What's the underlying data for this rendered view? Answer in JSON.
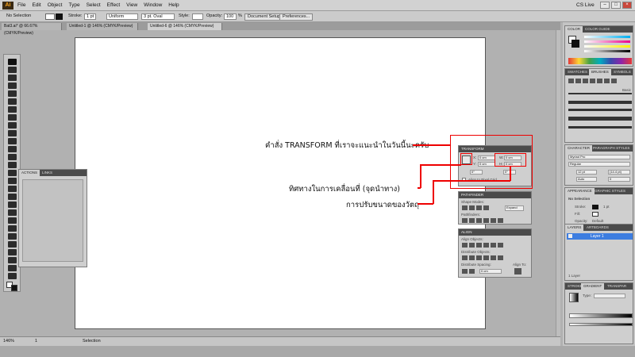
{
  "app": {
    "logo": "Ai",
    "menu": [
      "File",
      "Edit",
      "Object",
      "Type",
      "Select",
      "Effect",
      "View",
      "Window",
      "Help"
    ],
    "cs_live": "CS Live"
  },
  "window_controls": {
    "minimize": "–",
    "restore": "□",
    "close": "×"
  },
  "control_bar": {
    "selection": "No Selection",
    "stroke_label": "Stroke:",
    "stroke_value": "1 pt",
    "uniform": "Uniform",
    "brush": "3 pt. Oval",
    "style_label": "Style:",
    "opacity_label": "Opacity:",
    "opacity_value": "100",
    "opacity_unit": "%",
    "document_setup": "Document Setup",
    "preferences": "Preferences..."
  },
  "doc_tabs": [
    "Bat3.ai* @ 66.67% (CMYK/Preview)",
    "Untitled-1 @ 146% (CMYK/Preview)",
    "Untitled-6 @ 146% (CMYK/Preview)"
  ],
  "actions_panel": {
    "tab1": "ACTIONS",
    "tab2": "LINKS"
  },
  "transform_panel": {
    "title": "TRANSFORM",
    "x_label": "X:",
    "x_value": "0 cm",
    "y_label": "Y:",
    "y_value": "0 cm",
    "w_label": "W:",
    "w_value": "0 cm",
    "h_label": "H:",
    "h_value": "0 cm",
    "rotate_value": "0°",
    "shear_value": "0°",
    "align_grid": "Align to Pixel Grid"
  },
  "pathfinder_panel": {
    "title": "PATHFINDER",
    "shape_modes": "Shape Modes:",
    "expand": "Expand",
    "pathfinders": "Pathfinders:"
  },
  "align_panel": {
    "title": "ALIGN",
    "align_objects": "Align Objects:",
    "distribute_objects": "Distribute Objects:",
    "distribute_spacing": "Distribute Spacing:",
    "align_to": "Align To:",
    "spacing_value": "0 cm"
  },
  "annotations": {
    "transform_note": "คำสั่ง TRANSFORM ที่เราจะแนะนำในวันนี้นะครับ",
    "direction_note": "ทิศทางในการเคลื่อนที่ (จุดนำทาง)",
    "resize_note": "การปรับขนาดของวัตถุ"
  },
  "right_dock": {
    "color_tab": "COLOR",
    "color_guide_tab": "COLOR GUIDE",
    "swatches_tab": "SWATCHES",
    "brushes_tab": "BRUSHES",
    "symbols_tab": "SYMBOLS",
    "brush_basic": "Basic",
    "character_tab": "CHARACTER",
    "paragraph_tab": "PARAGRAPH STYLES",
    "font": "Myriad Pro",
    "font_style": "Regular",
    "font_size": "12 pt",
    "leading": "(14.4 pt)",
    "kerning": "Auto",
    "tracking": "0",
    "appearance_tab": "APPEARANCE",
    "graphic_styles_tab": "GRAPHIC STYLES",
    "no_selection": "No Selection",
    "stroke_label": "Stroke:",
    "stroke_value": "1 pt",
    "fill_label": "Fill:",
    "opacity_label": "Opacity:",
    "opacity_value": "Default",
    "layers_tab": "LAYERS",
    "artboards_tab": "ARTBOARDS",
    "layer_name": "Layer 1",
    "layer_count": "1 Layer",
    "stroke_tab": "STROKE",
    "gradient_tab": "GRADIENT",
    "transparency_tab": "TRANSPAR",
    "type_label": "Type:"
  },
  "status_bar": {
    "zoom": "146%",
    "page": "1",
    "tool": "Selection"
  },
  "colors": {
    "annotation_red": "#e00000",
    "panel_header": "#4b4b4b",
    "layer_highlight": "#3d7de0"
  }
}
